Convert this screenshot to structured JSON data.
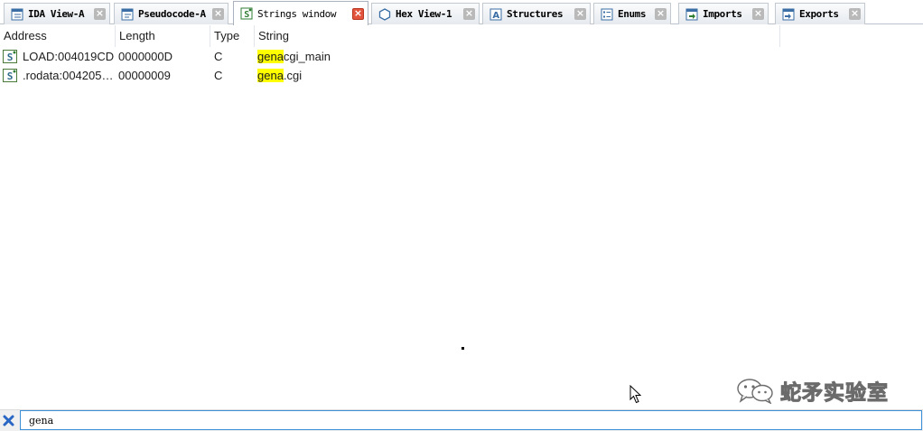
{
  "tabs": [
    {
      "label": "IDA View-A",
      "icon": "ida-view-icon",
      "active": false
    },
    {
      "label": "Pseudocode-A",
      "icon": "pseudocode-icon",
      "active": false
    },
    {
      "label": "Strings window",
      "icon": "strings-icon",
      "active": true
    },
    {
      "label": "Hex View-1",
      "icon": "hex-view-icon",
      "active": false
    },
    {
      "label": "Structures",
      "icon": "structures-icon",
      "active": false
    },
    {
      "label": "Enums",
      "icon": "enums-icon",
      "active": false
    },
    {
      "label": "Imports",
      "icon": "imports-icon",
      "active": false
    },
    {
      "label": "Exports",
      "icon": "exports-icon",
      "active": false
    }
  ],
  "table": {
    "columns": [
      "Address",
      "Length",
      "Type",
      "String"
    ],
    "rows": [
      {
        "address": "LOAD:004019CD",
        "length": "0000000D",
        "type": "C",
        "match": "gena",
        "rest": "cgi_main"
      },
      {
        "address": ".rodata:004205…",
        "length": "00000009",
        "type": "C",
        "match": "gena",
        "rest": ".cgi"
      }
    ]
  },
  "colors": {
    "highlight": "#ffff00",
    "active_close": "#e2553c",
    "filter_border": "#3b8fd6"
  },
  "watermark": {
    "text": "蛇矛实验室"
  },
  "filter": {
    "value": "gena"
  }
}
